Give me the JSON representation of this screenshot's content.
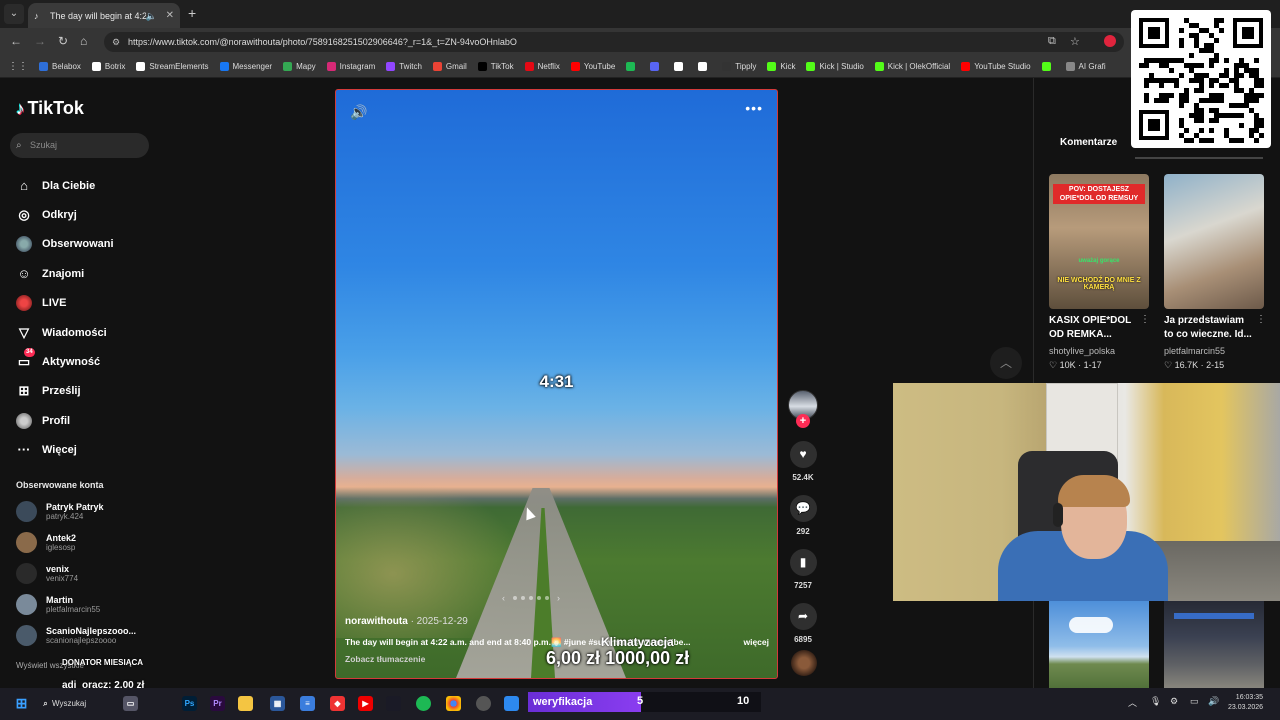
{
  "browser": {
    "tab_title": "The day will begin at 4:22 a",
    "url": "https://www.tiktok.com/@norawithouta/photo/7589168251502906646?_r=1&_t=ZN-94voOHnlabO",
    "bookmarks": [
      {
        "label": "Belabox",
        "color": "#2e6fd9"
      },
      {
        "label": "Botrix",
        "color": "#ffffff"
      },
      {
        "label": "StreamElements",
        "color": "#ffffff"
      },
      {
        "label": "Messenger",
        "color": "#1877f2"
      },
      {
        "label": "Mapy",
        "color": "#34a853"
      },
      {
        "label": "Instagram",
        "color": "#d62976"
      },
      {
        "label": "Twitch",
        "color": "#9146ff"
      },
      {
        "label": "Gmail",
        "color": "#ea4335"
      },
      {
        "label": "TikTok",
        "color": "#000000"
      },
      {
        "label": "Netflix",
        "color": "#e50914"
      },
      {
        "label": "YouTube",
        "color": "#ff0000"
      },
      {
        "label": "",
        "color": "#1db954"
      },
      {
        "label": "",
        "color": "#5865f2"
      },
      {
        "label": "",
        "color": "#ffffff"
      },
      {
        "label": "",
        "color": "#ffffff"
      },
      {
        "label": "Tipply",
        "color": "#333333"
      },
      {
        "label": "Kick",
        "color": "#53fc18"
      },
      {
        "label": "Kick | Studio",
        "color": "#53fc18"
      },
      {
        "label": "Kick | OlekOfficial",
        "color": "#53fc18"
      },
      {
        "label": "YouTube Studio",
        "color": "#ff0000"
      },
      {
        "label": "",
        "color": "#53fc18"
      },
      {
        "label": "AI Grafi",
        "color": "#888888"
      }
    ]
  },
  "tiktok": {
    "logo": "TikTok",
    "search_placeholder": "Szukaj",
    "nav": [
      {
        "label": "Dla Ciebie",
        "icon": "home-icon",
        "glyph": "⌂"
      },
      {
        "label": "Odkryj",
        "icon": "compass-icon",
        "glyph": "◎"
      },
      {
        "label": "Obserwowani",
        "icon": "following-avatar-icon",
        "glyph": ""
      },
      {
        "label": "Znajomi",
        "icon": "friends-icon",
        "glyph": "☺"
      },
      {
        "label": "LIVE",
        "icon": "live-avatar-icon",
        "glyph": ""
      },
      {
        "label": "Wiadomości",
        "icon": "messages-icon",
        "glyph": "▽"
      },
      {
        "label": "Aktywność",
        "icon": "activity-icon",
        "glyph": "▭"
      },
      {
        "label": "Prześlij",
        "icon": "upload-icon",
        "glyph": "⊞"
      },
      {
        "label": "Profil",
        "icon": "profile-avatar-icon",
        "glyph": ""
      },
      {
        "label": "Więcej",
        "icon": "more-icon",
        "glyph": "···"
      }
    ],
    "activity_badge": "34",
    "following_header": "Obserwowane konta",
    "following": [
      {
        "name": "Patryk Patryk",
        "handle": "patryk.424",
        "color": "#3b4a5a"
      },
      {
        "name": "Antek2",
        "handle": "iglesosp",
        "color": "#8a6a4a"
      },
      {
        "name": "venix",
        "handle": "venix774",
        "color": "#2a2a2a"
      },
      {
        "name": "Martin",
        "handle": "pletfalmarcin55",
        "color": "#7a8a9a"
      },
      {
        "name": "ScanioNajlepszooo...",
        "handle": "scanionajlepszoooo",
        "color": "#4a5a6a"
      }
    ],
    "show_all": "Wyświetl wszystkie"
  },
  "video": {
    "timer": "4:31",
    "author": "norawithouta",
    "date": "2025-12-29",
    "description": "The day will begin at 4:22 a.m. and end at 8:40 p.m.🌅 #june #summer #summervibe...",
    "more": "więcej",
    "translate": "Zobacz tłumaczenie",
    "likes": "52.4K",
    "comments": "292",
    "saves": "7257",
    "shares": "6895"
  },
  "right": {
    "tab": "Komentarze",
    "cards": [
      {
        "title_line1": "KASIX OPIE*DOL",
        "title_line2": "OD REMKA...",
        "author": "shotylive_polska",
        "likes": "10K",
        "date": "1-17",
        "headline": "POV: DOSTAJESZ OPIE*DOL OD REMSUY",
        "green": "uważaj gorące",
        "neg": "NIE WCHODŹ DO MNIE Z KAMERĄ"
      },
      {
        "title_line1": "Ja przedstawiam",
        "title_line2": "to co wieczne. Id...",
        "author": "pletfalmarcin55",
        "likes": "16.7K",
        "date": "2-15"
      }
    ]
  },
  "overlay": {
    "donation_name": "Klimatyzacja",
    "amount_current": "6,00 zł",
    "amount_goal": "1000,00 zł",
    "donator_label": "DONATOR MIESIĄCA",
    "donator_value": "adi_oracz: 2,00 zł",
    "verif_label": "weryfikacja",
    "verif_a": "5",
    "verif_b": "10"
  },
  "taskbar": {
    "search": "Wyszukaj",
    "time": "16:03:35",
    "date": "23.03.2026"
  }
}
